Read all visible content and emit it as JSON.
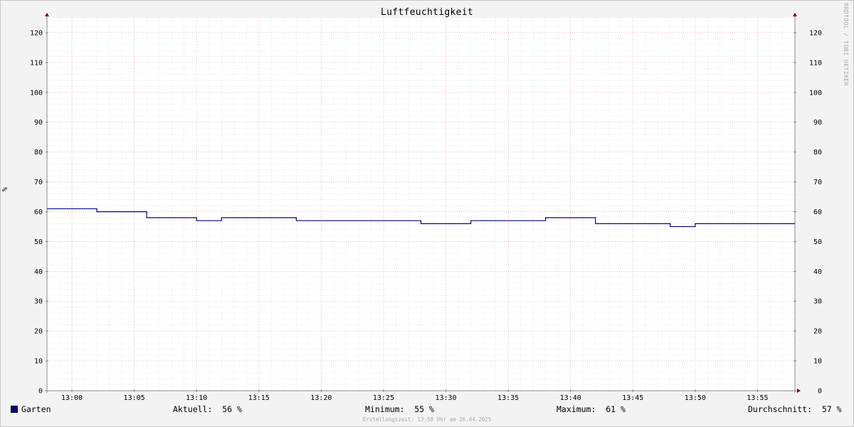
{
  "title": "Luftfeuchtigkeit",
  "watermark": "RRDTOOL / TOBI OETIKER",
  "footer": "Erstellungszeit: 13:58 Uhr am 26.04.2025",
  "colors": {
    "background": "#f3f3f3",
    "plot_background": "#ffffff",
    "minor_grid": "#d6d6d6",
    "major_grid": "#e0a0a0",
    "axis": "#888888",
    "arrow": "#8b0000",
    "series": "#000080"
  },
  "legend": {
    "series_name": "Garten",
    "swatch_color": "#000080",
    "aktuell": "Aktuell:  56 %",
    "minimum": "Minimum:  55 %",
    "maximum": "Maximum:  61 %",
    "durchschnitt": "Durchschnitt:  57 %"
  },
  "chart_data": {
    "type": "line",
    "title": "Luftfeuchtigkeit",
    "ylabel": "%",
    "xlabel": "",
    "ylim": [
      0,
      125
    ],
    "y_ticks": [
      0,
      10,
      20,
      30,
      40,
      50,
      60,
      70,
      80,
      90,
      100,
      110,
      120
    ],
    "x_range": [
      "12:58",
      "13:58"
    ],
    "x_ticks": [
      "13:00",
      "13:05",
      "13:10",
      "13:15",
      "13:20",
      "13:25",
      "13:30",
      "13:35",
      "13:40",
      "13:45",
      "13:50",
      "13:55"
    ],
    "grid": true,
    "legend_position": "bottom",
    "series": [
      {
        "name": "Garten",
        "color": "#000080",
        "step": true,
        "points": [
          {
            "x": "12:58",
            "y": 61
          },
          {
            "x": "13:02",
            "y": 60
          },
          {
            "x": "13:06",
            "y": 58
          },
          {
            "x": "13:10",
            "y": 57
          },
          {
            "x": "13:12",
            "y": 58
          },
          {
            "x": "13:18",
            "y": 57
          },
          {
            "x": "13:28",
            "y": 56
          },
          {
            "x": "13:32",
            "y": 57
          },
          {
            "x": "13:38",
            "y": 58
          },
          {
            "x": "13:42",
            "y": 56
          },
          {
            "x": "13:44",
            "y": 56
          },
          {
            "x": "13:48",
            "y": 55
          },
          {
            "x": "13:50",
            "y": 56
          },
          {
            "x": "13:58",
            "y": 56
          }
        ]
      }
    ]
  }
}
